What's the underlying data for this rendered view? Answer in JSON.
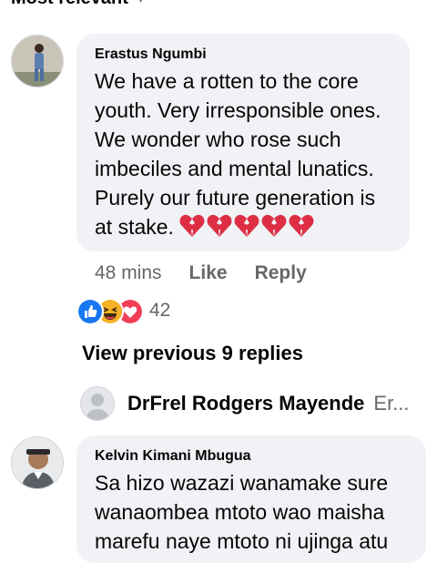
{
  "sort": {
    "label": "Most relevant"
  },
  "comments": [
    {
      "author": "Erastus Ngumbi",
      "lines": [
        "We have a rotten to the core",
        "youth. Very irresponsible ones.",
        "We wonder who rose such",
        "imbeciles and mental lunatics.",
        "Purely our future generation is",
        "at stake."
      ],
      "emoji": "broken-heart x5",
      "time": "48 mins",
      "like_label": "Like",
      "reply_label": "Reply",
      "reaction_icons": [
        "like-icon",
        "haha-icon",
        "love-icon"
      ],
      "reaction_count": "42"
    },
    {
      "author": "Kelvin Kimani Mbugua",
      "lines": [
        "Sa hizo wazazi wanamake sure",
        "wanaombea mtoto wao maisha",
        "marefu naye mtoto ni ujinga atu"
      ]
    }
  ],
  "view_previous": "View previous 9 replies",
  "reply_preview": {
    "name": "DrFrel Rodgers Mayende",
    "snippet": "Er..."
  },
  "colors": {
    "bubble": "#f0f2f5",
    "like_blue": "#1877f2",
    "love_red": "#f33e58",
    "haha_yellow": "#f7b125",
    "muted": "#65676b"
  }
}
